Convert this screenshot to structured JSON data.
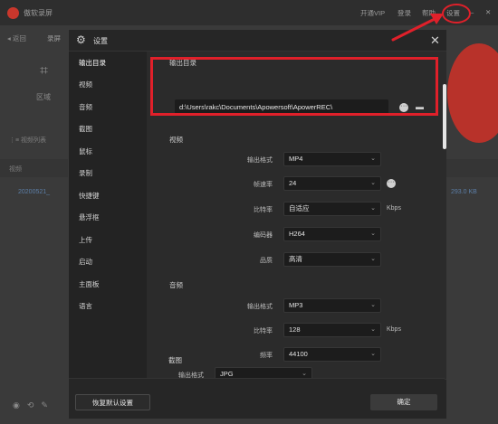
{
  "bg": {
    "app_title": "傲软录屏",
    "menu": {
      "vip": "开通VIP",
      "login": "登录",
      "help": "帮助",
      "settings": "设置"
    },
    "back": "◂ 返回",
    "rec_tab": "录屏",
    "region": "区域",
    "list_label": "⋮≡  视频列表",
    "video_tab": "视频",
    "file_name": "20200521_",
    "file_size": "293.0 KB"
  },
  "dialog": {
    "title": "设置",
    "nav": [
      {
        "label": "输出目录",
        "active": true
      },
      {
        "label": "视频"
      },
      {
        "label": "音频"
      },
      {
        "label": "截图"
      },
      {
        "label": "鼠标"
      },
      {
        "label": "录制"
      },
      {
        "label": "快捷键"
      },
      {
        "label": "悬浮框"
      },
      {
        "label": "上传"
      },
      {
        "label": "启动"
      },
      {
        "label": "主面板"
      },
      {
        "label": "语言"
      }
    ],
    "output": {
      "heading": "输出目录",
      "path": "d:\\Users\\rakc\\Documents\\Apowersoft\\ApowerREC\\"
    },
    "video": {
      "heading": "视频",
      "format_label": "输出格式",
      "format_value": "MP4",
      "fps_label": "帧速率",
      "fps_value": "24",
      "bitrate_label": "比特率",
      "bitrate_value": "自适应",
      "bitrate_unit": "Kbps",
      "encoder_label": "编码器",
      "encoder_value": "H264",
      "quality_label": "品质",
      "quality_value": "高清"
    },
    "audio": {
      "heading": "音频",
      "format_label": "输出格式",
      "format_value": "MP3",
      "bitrate_label": "比特率",
      "bitrate_value": "128",
      "bitrate_unit": "Kbps",
      "freq_label": "频率",
      "freq_value": "44100"
    },
    "screenshot": {
      "heading": "截图",
      "format_label": "输出格式",
      "format_value": "JPG"
    },
    "footer": {
      "reset_label": "恢复默认设置",
      "ok_label": "确定"
    }
  },
  "colors": {
    "annotation_red": "#e0202a",
    "dialog_bg": "#232323",
    "content_bg": "#2b2b2b"
  }
}
